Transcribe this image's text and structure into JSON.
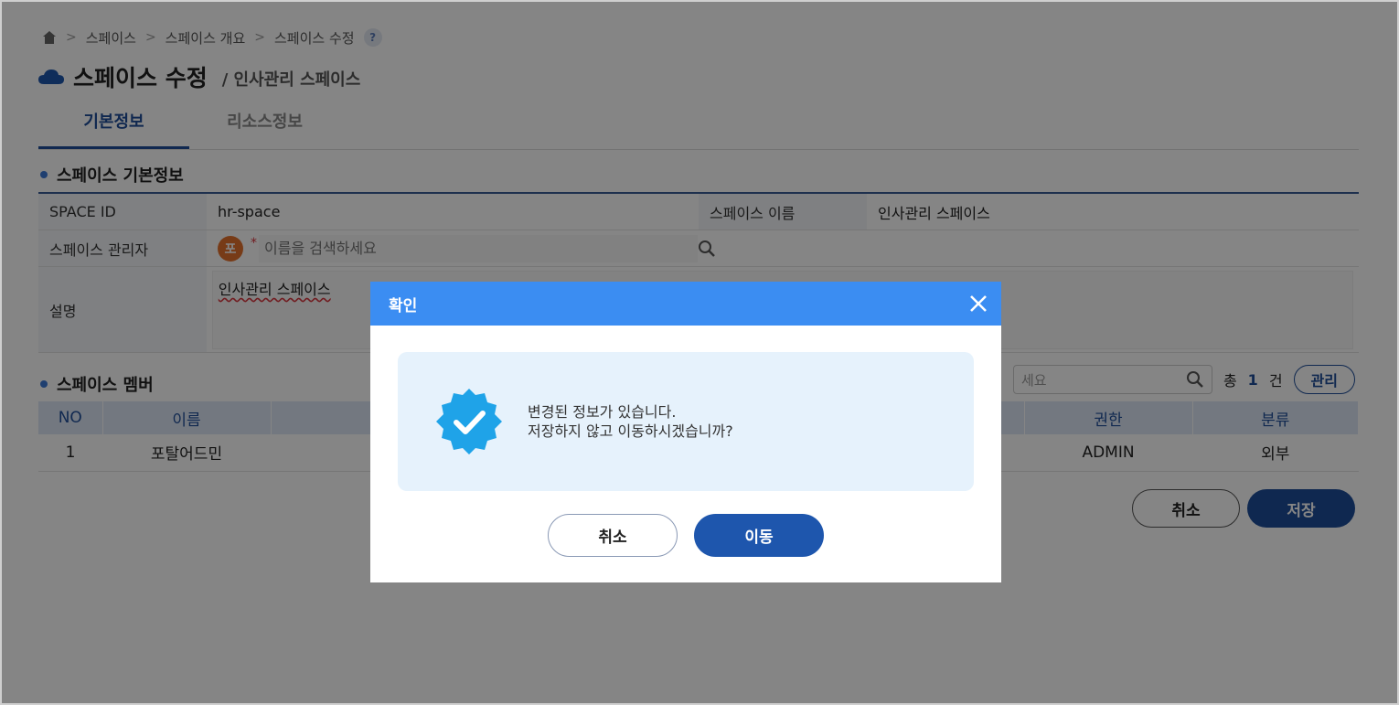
{
  "breadcrumb": {
    "items": [
      "스페이스",
      "스페이스 개요",
      "스페이스 수정"
    ],
    "help": "?"
  },
  "page": {
    "title": "스페이스 수정",
    "subtitle": "/ 인사관리 스페이스"
  },
  "tabs": [
    {
      "label": "기본정보"
    },
    {
      "label": "리소스정보"
    }
  ],
  "basic_info": {
    "section_title": "스페이스 기본정보",
    "space_id_label": "SPACE ID",
    "space_id_value": "hr-space",
    "space_name_label": "스페이스 이름",
    "space_name_value": "인사관리 스페이스",
    "manager_label": "스페이스 관리자",
    "manager_badge": "포",
    "required_mark": "*",
    "manager_placeholder": "이름을 검색하세요",
    "desc_label": "설명",
    "desc_value": "인사관리 스페이스"
  },
  "members": {
    "section_title": "스페이스 멤버",
    "search_placeholder": "세요",
    "total_label": "총",
    "total_count": "1",
    "count_unit": "건",
    "manage_label": "관리",
    "columns": [
      "NO",
      "이름",
      "권한",
      "분류"
    ],
    "rows": [
      {
        "no": "1",
        "name": "포탈어드민",
        "role": "ADMIN",
        "type": "외부"
      }
    ]
  },
  "actions": {
    "cancel": "취소",
    "save": "저장"
  },
  "modal": {
    "title": "확인",
    "message_line1": "변경된 정보가 있습니다.",
    "message_line2": "저장하지 않고 이동하시겠습니까?",
    "cancel": "취소",
    "confirm": "이동"
  },
  "colors": {
    "primary": "#1e56ad",
    "header_blue": "#3b8df2",
    "accent_orange": "#e5712d",
    "verified": "#1fa3e8"
  }
}
